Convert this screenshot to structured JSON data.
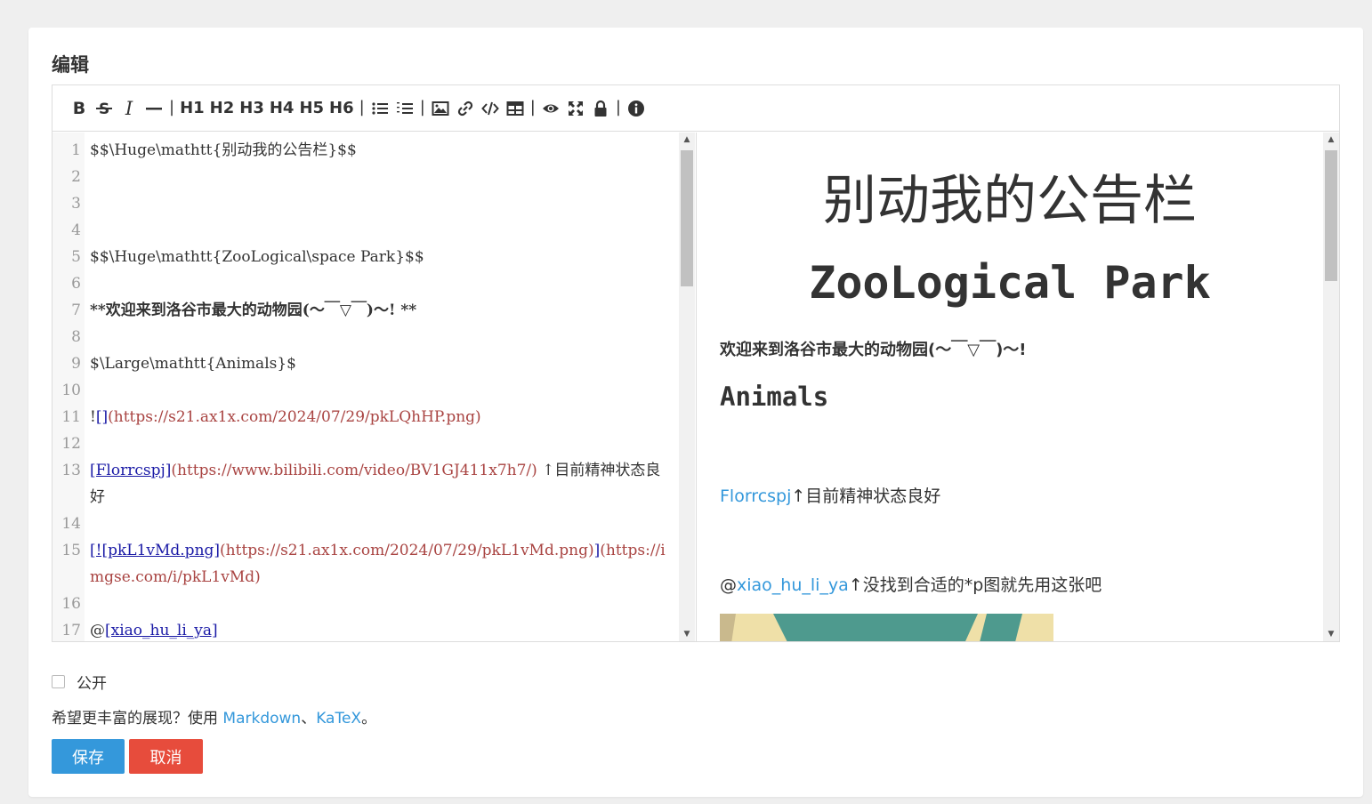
{
  "card": {
    "title": "编辑"
  },
  "toolbar": {
    "h1": "H1",
    "h2": "H2",
    "h3": "H3",
    "h4": "H4",
    "h5": "H5",
    "h6": "H6",
    "bold": "B",
    "italic": "I",
    "sep": "|",
    "icons": [
      "bold-icon",
      "strikethrough-icon",
      "italic-icon",
      "hr-icon",
      "list-ul-icon",
      "list-ol-icon",
      "image-icon",
      "link-icon",
      "code-icon",
      "table-icon",
      "eye-icon",
      "fullscreen-icon",
      "lock-icon",
      "info-icon"
    ]
  },
  "code": {
    "lines": [
      {
        "n": "1",
        "t": "$$\\Huge\\mathtt{别动我的公告栏}$$"
      },
      {
        "n": "2",
        "t": ""
      },
      {
        "n": "3",
        "t": ""
      },
      {
        "n": "4",
        "t": ""
      },
      {
        "n": "5",
        "t": "$$\\Huge\\mathtt{ZooLogical\\space Park}$$"
      },
      {
        "n": "6",
        "t": ""
      },
      {
        "n": "7",
        "t": "**欢迎来到洛谷市最大的动物园(～￣▽￣)～! **"
      },
      {
        "n": "8",
        "t": ""
      },
      {
        "n": "9",
        "t": "$\\Large\\mathtt{Animals}$"
      },
      {
        "n": "10",
        "t": ""
      },
      {
        "n": "11",
        "a": "!",
        "b": "[]",
        "c": "(https://s21.ax1x.com/2024/07/29/pkLQhHP.png)"
      },
      {
        "n": "12",
        "t": ""
      },
      {
        "n": "13",
        "a": "",
        "b": "[Florrcspj]",
        "c": "(https://www.bilibili.com/video/BV1GJ411x7h7/)",
        "d": " ↑目前精神状态良好"
      },
      {
        "n": "14",
        "t": ""
      },
      {
        "n": "15",
        "a": "",
        "b": "[![pkL1vMd.png]",
        "c": "(https://s21.ax1x.com/2024/07/29/pkL1vMd.png)",
        "e": "]",
        "f": "(https://imgse.com/i/pkL1vMd)"
      },
      {
        "n": "16",
        "t": ""
      },
      {
        "n": "17",
        "a": "@",
        "b": "[xiao_hu_li_ya]"
      }
    ]
  },
  "preview": {
    "h1": "别动我的公告栏",
    "h2": "ZooLogical Park",
    "welcome": "欢迎来到洛谷市最大的动物园(～￣▽￣)～!",
    "animals": "Animals",
    "line1_link": "Florrcspj",
    "line1_text": "↑目前精神状态良好",
    "line2_at": "@",
    "line2_link": "xiao_hu_li_ya",
    "line2_text": "↑没找到合适的*p图就先用这张吧"
  },
  "footer": {
    "public_label": "公开",
    "hint_prefix": "希望更丰富的展现？使用 ",
    "markdown": "Markdown",
    "sep": "、",
    "katex": "KaTeX",
    "hint_suffix": "。",
    "save": "保存",
    "cancel": "取消"
  },
  "colors": {
    "accent": "#3498db",
    "danger": "#e74c3c",
    "url": "#a94442"
  }
}
